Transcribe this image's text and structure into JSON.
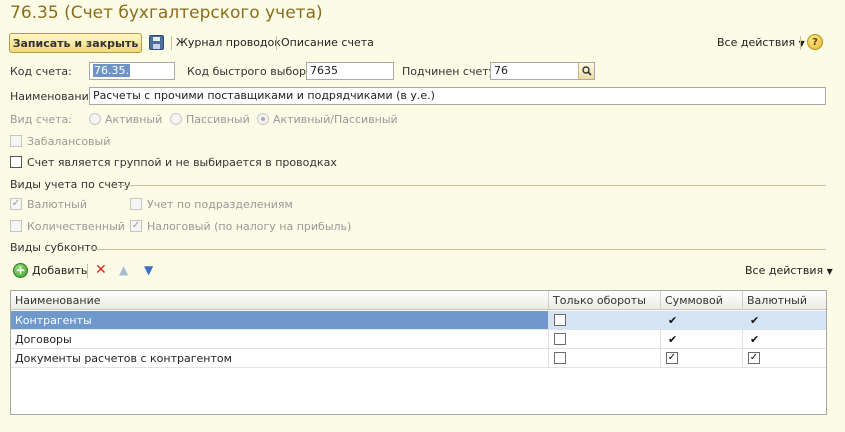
{
  "form": {
    "title": "76.35 (Счет бухгалтерского учета)"
  },
  "toolbar": {
    "save_close_label": "Записать и закрыть",
    "journal_label": "Журнал проводок",
    "description_label": "Описание счета",
    "all_actions_label": "Все действия",
    "help_label": "?"
  },
  "fields": {
    "code_label": "Код счета:",
    "code_value": "76.35.",
    "quick_code_label": "Код быстрого выбора:",
    "quick_code_value": "7635",
    "parent_label": "Подчинен счету:",
    "parent_value": "76",
    "name_label": "Наименование:",
    "name_value": "Расчеты с прочими поставщиками и подрядчиками (в у.е.)",
    "type_label": "Вид счета:",
    "type_options": [
      "Активный",
      "Пассивный",
      "Активный/Пассивный"
    ],
    "type_selected": "Активный/Пассивный",
    "off_balance_label": "Забалансовый",
    "is_group_label": "Счет является группой и не выбирается в проводках"
  },
  "accounting_types": {
    "group_title": "Виды учета по счету",
    "currency_label": "Валютный",
    "currency_checked": true,
    "quantity_label": "Количественный",
    "quantity_checked": false,
    "division_label": "Учет по подразделениям",
    "division_checked": false,
    "tax_label": "Налоговый (по налогу на прибыль)",
    "tax_checked": true
  },
  "subconto": {
    "group_title": "Виды субконто",
    "add_label": "Добавить",
    "all_actions_label": "Все действия",
    "columns": [
      "Наименование",
      "Только обороты",
      "Суммовой",
      "Валютный"
    ],
    "rows": [
      {
        "name": "Контрагенты",
        "turnover_only": false,
        "sum": true,
        "currency": true
      },
      {
        "name": "Договоры",
        "turnover_only": false,
        "sum": true,
        "currency": true
      },
      {
        "name": "Документы расчетов с контрагентом",
        "turnover_only": false,
        "sum": true,
        "currency": true
      }
    ],
    "selected_row": 0
  }
}
